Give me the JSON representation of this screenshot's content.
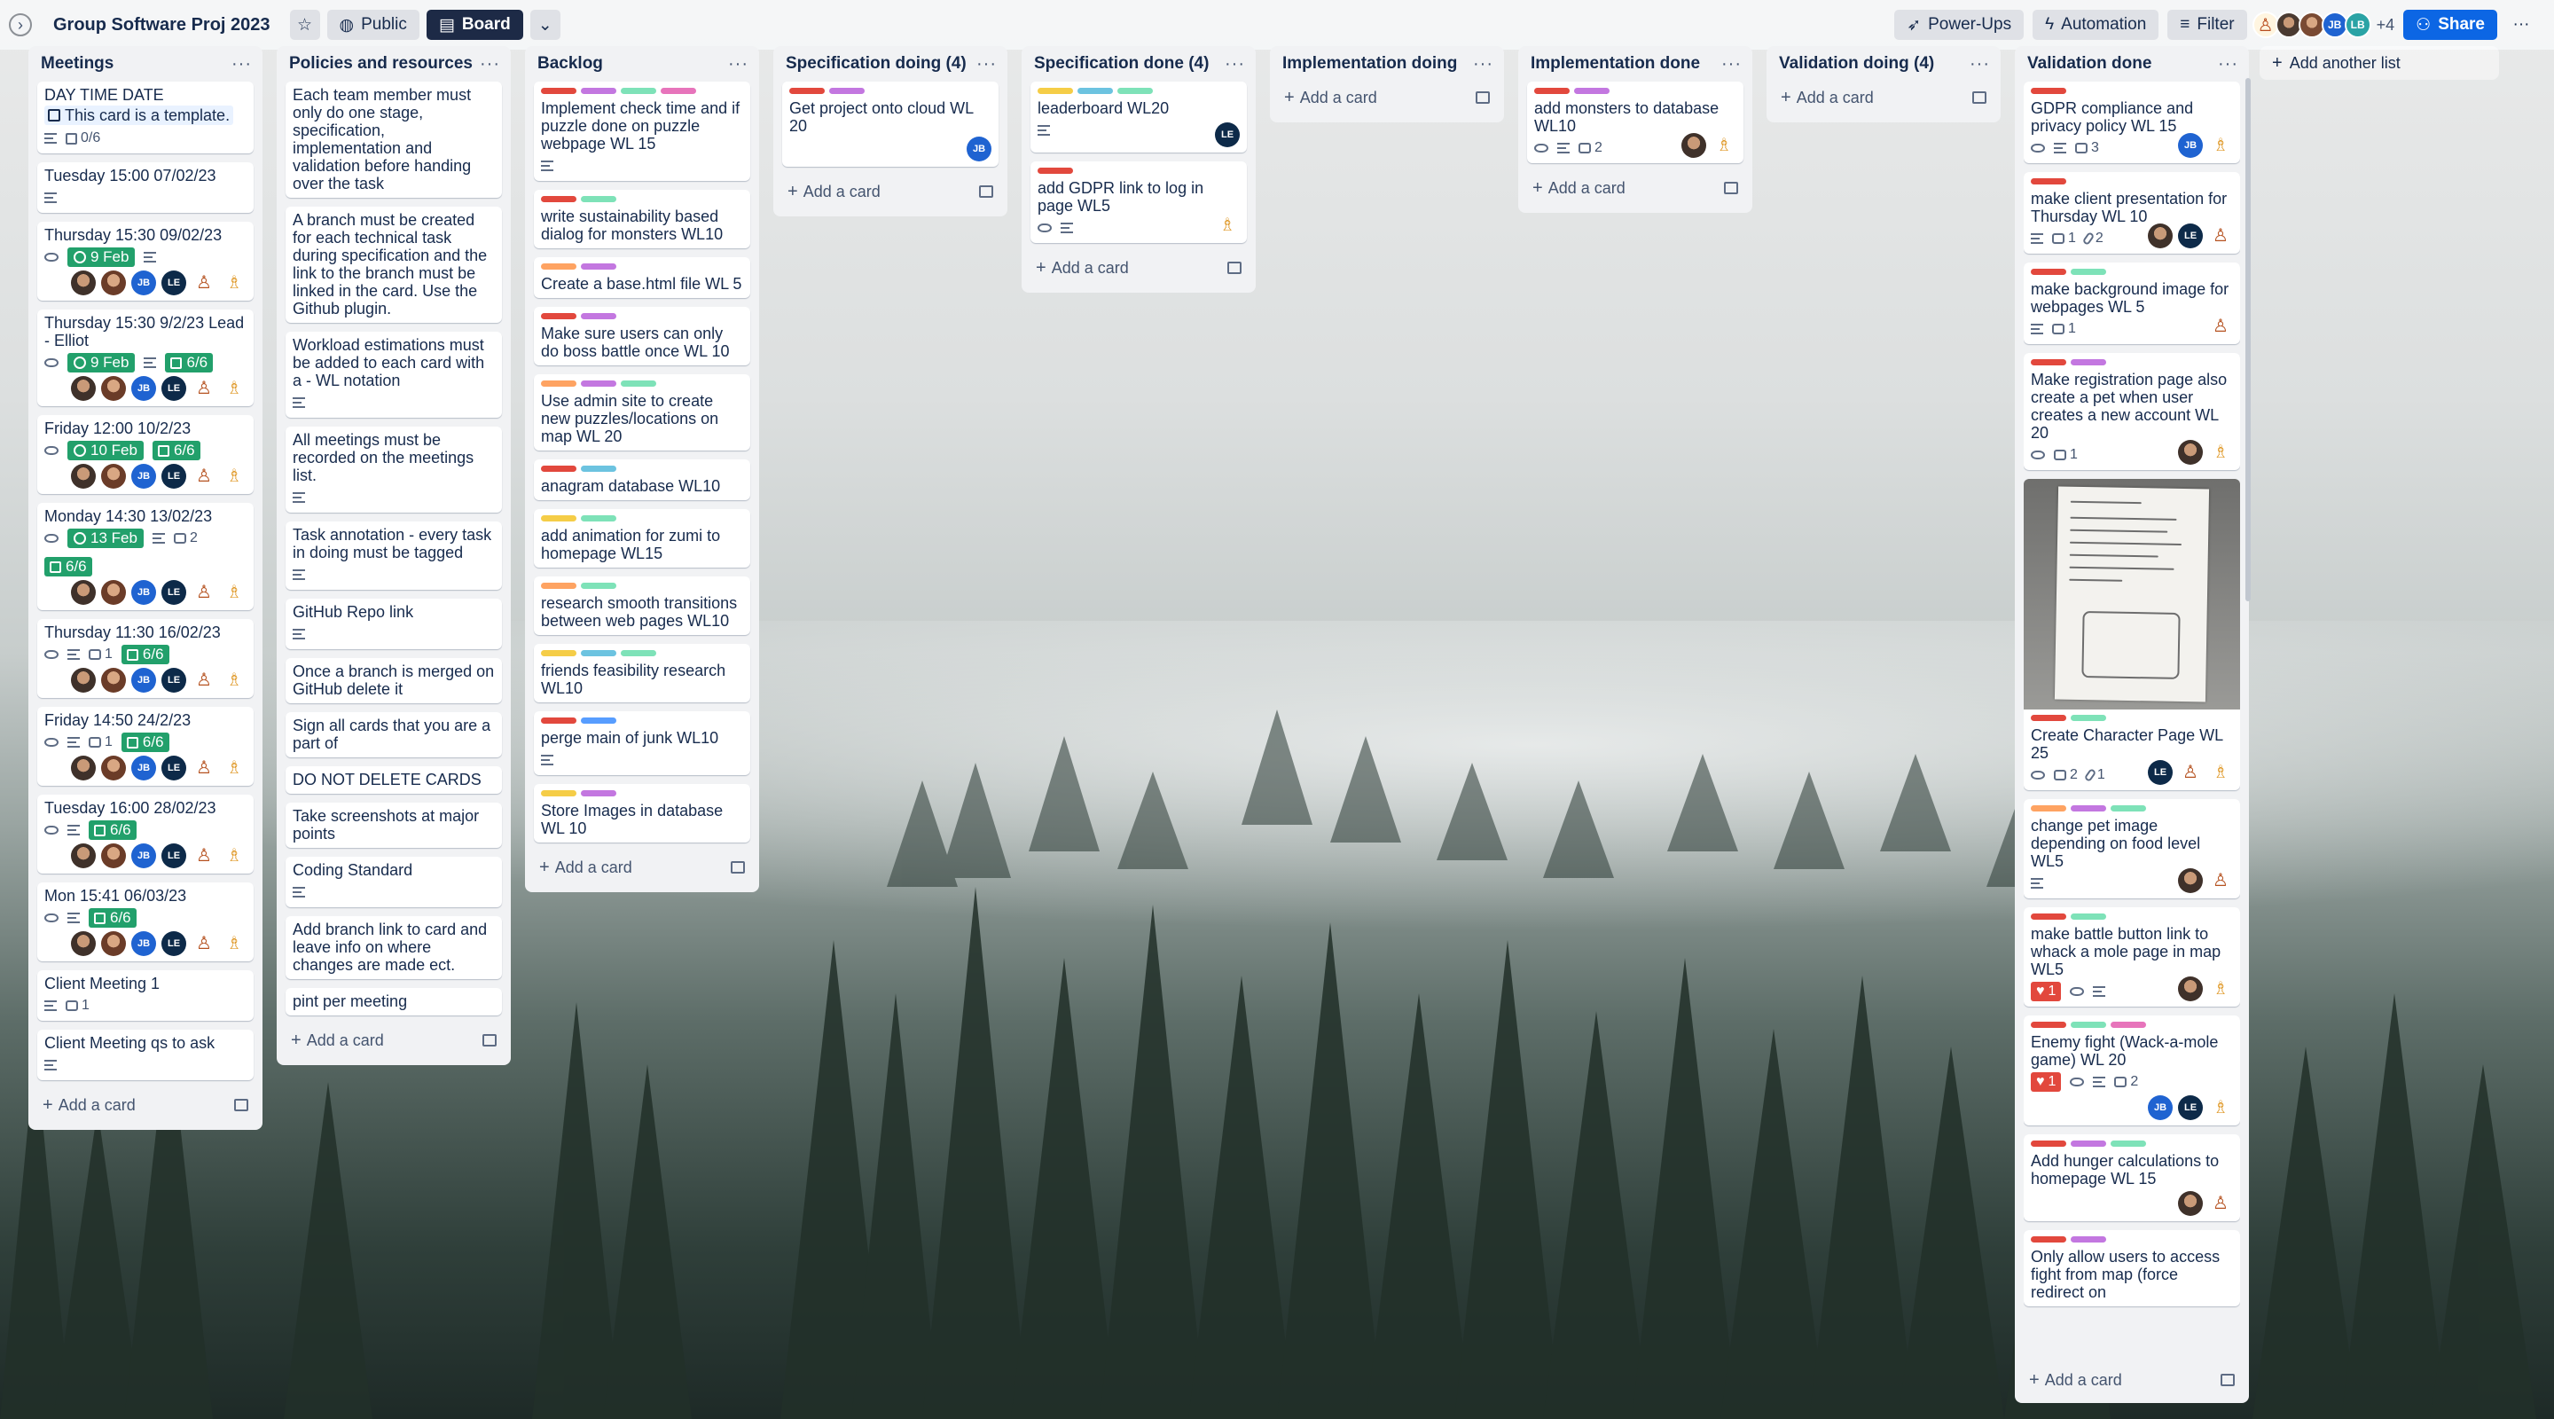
{
  "header": {
    "board_title": "Group Software Proj 2023",
    "visibility": "Public",
    "view": "Board",
    "power_ups": "Power-Ups",
    "automation": "Automation",
    "filter": "Filter",
    "member_overflow": "+4",
    "share": "Share",
    "member_initials": [
      "JB",
      "LB"
    ]
  },
  "colors": {
    "red": "#e2483d",
    "purple": "#c377e0",
    "green": "#7ee2b8",
    "yellow": "#f5cd47",
    "orange": "#fea362",
    "pink": "#e774bb",
    "sky": "#6cc3e0",
    "blue": "#579dff",
    "due_green": "#22a06b"
  },
  "add_card_label": "Add a card",
  "add_list_label": "Add another list",
  "lists": [
    {
      "title": "Meetings",
      "cards": [
        {
          "title": "DAY TIME DATE",
          "template_note": "This card is a template.",
          "checklist": "0/6"
        },
        {
          "title": "Tuesday 15:00 07/02/23"
        },
        {
          "title": "Thursday 15:30 09/02/23",
          "due": "9 Feb"
        },
        {
          "title": "Thursday 15:30 9/2/23 Lead - Elliot",
          "due": "9 Feb",
          "checklist": "6/6"
        },
        {
          "title": "Friday 12:00 10/2/23",
          "due": "10 Feb",
          "checklist": "6/6"
        },
        {
          "title": "Monday 14:30 13/02/23",
          "due": "13 Feb",
          "comments": "2",
          "checklist": "6/6"
        },
        {
          "title": "Thursday 11:30 16/02/23",
          "comments": "1",
          "checklist": "6/6"
        },
        {
          "title": "Friday 14:50 24/2/23",
          "comments": "1",
          "checklist": "6/6"
        },
        {
          "title": "Tuesday 16:00 28/02/23",
          "checklist": "6/6"
        },
        {
          "title": "Mon 15:41 06/03/23",
          "checklist": "6/6"
        },
        {
          "title": "Client Meeting 1",
          "comments": "1"
        },
        {
          "title": "Client Meeting qs to ask"
        }
      ]
    },
    {
      "title": "Policies and resources",
      "cards": [
        {
          "title": "Each team member must only do one stage, specification, implementation and validation before handing over the task"
        },
        {
          "title": "A branch must be created for each technical task during specification and the link to the branch must be linked in the card. Use the Github plugin."
        },
        {
          "title": "Workload estimations must be added to each card with a - WL notation"
        },
        {
          "title": "All meetings must be recorded on the meetings list."
        },
        {
          "title": "Task annotation - every task in doing must be tagged"
        },
        {
          "title": "GitHub Repo link"
        },
        {
          "title": "Once a branch is merged on GitHub delete it"
        },
        {
          "title": "Sign all cards that you are a part of"
        },
        {
          "title": "DO NOT DELETE CARDS"
        },
        {
          "title": "Take screenshots at major points"
        },
        {
          "title": "Coding Standard"
        },
        {
          "title": "Add branch link to card and leave info on where changes are made ect."
        },
        {
          "title": "pint per meeting"
        }
      ]
    },
    {
      "title": "Backlog",
      "cards": [
        {
          "title": "Implement check time and if puzzle done on puzzle webpage WL 15"
        },
        {
          "title": "write sustainability based dialog for monsters WL10"
        },
        {
          "title": "Create a base.html file WL 5"
        },
        {
          "title": "Make sure users can only do boss battle once WL 10"
        },
        {
          "title": "Use admin site to create new puzzles/locations on map WL 20"
        },
        {
          "title": "anagram database WL10"
        },
        {
          "title": "add animation for zumi to homepage WL15"
        },
        {
          "title": "research smooth transitions between web pages WL10"
        },
        {
          "title": "friends feasibility research WL10"
        },
        {
          "title": "perge main of junk WL10"
        },
        {
          "title": "Store Images in database WL 10"
        }
      ]
    },
    {
      "title": "Specification doing (4)",
      "cards": [
        {
          "title": "Get project onto cloud WL 20"
        }
      ]
    },
    {
      "title": "Specification done (4)",
      "cards": [
        {
          "title": "leaderboard WL20"
        },
        {
          "title": "add GDPR link to log in page WL5"
        }
      ]
    },
    {
      "title": "Implementation doing",
      "cards": []
    },
    {
      "title": "Implementation done",
      "cards": [
        {
          "title": "add monsters to database WL10",
          "comments": "2"
        }
      ]
    },
    {
      "title": "Validation doing (4)",
      "cards": []
    },
    {
      "title": "Validation done",
      "cards": [
        {
          "title": "GDPR compliance and privacy policy WL 15",
          "comments": "3"
        },
        {
          "title": "make client presentation for Thursday WL 10",
          "comments": "1",
          "attachments": "2"
        },
        {
          "title": "make background image for webpages WL 5",
          "comments": "1"
        },
        {
          "title": "Make registration page also create a pet when user creates a new account WL 20",
          "comments": "1"
        },
        {
          "title": "Create Character Page WL 25",
          "comments": "2",
          "attachments": "1"
        },
        {
          "title": "change pet image depending on food level WL5"
        },
        {
          "title": "make battle button link to whack a mole page in map WL5",
          "votes": "1"
        },
        {
          "title": "Enemy fight (Wack-a-mole game) WL 20",
          "votes": "1",
          "comments": "2"
        },
        {
          "title": "Add hunger calculations to homepage WL 15"
        },
        {
          "title": "Only allow users to access fight from map (force redirect on"
        }
      ]
    }
  ]
}
